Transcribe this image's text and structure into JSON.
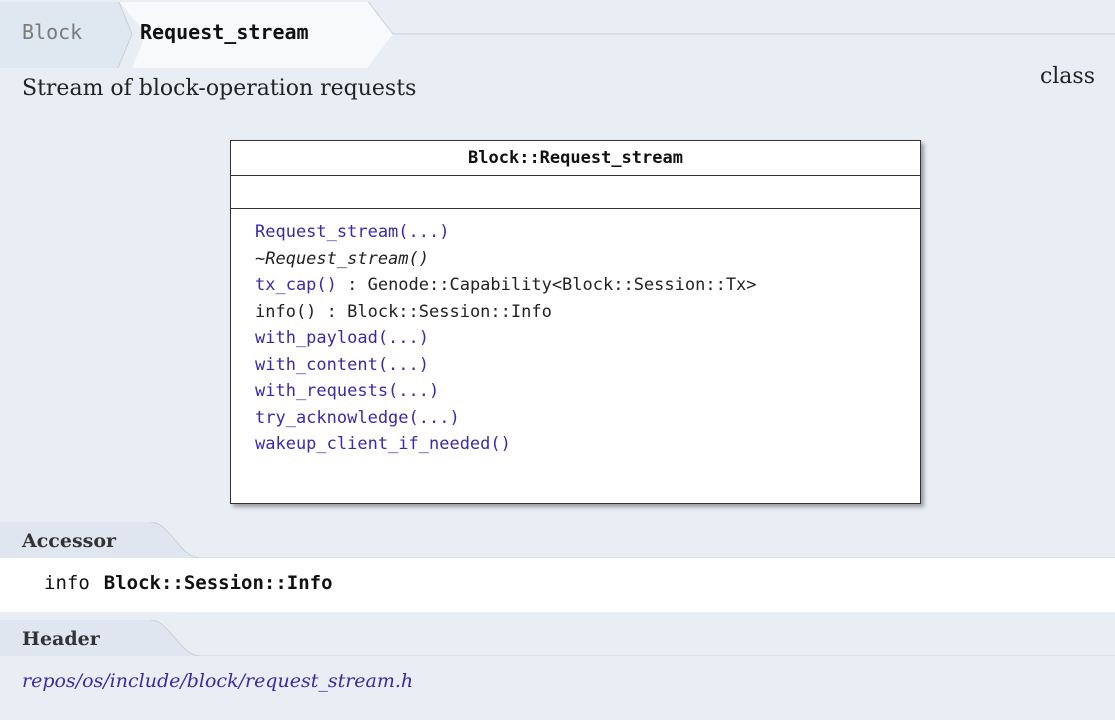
{
  "breadcrumb": {
    "parent": "Block",
    "current": "Request_stream"
  },
  "kind": "class",
  "brief": "Stream of block-operation requests",
  "uml": {
    "title": "Block::Request_stream",
    "methods": [
      {
        "name": "Request_stream(...)",
        "suffix": "",
        "link": true,
        "italic": false
      },
      {
        "name": "~Request_stream()",
        "suffix": "",
        "link": false,
        "italic": true
      },
      {
        "name": "tx_cap()",
        "suffix": " : Genode::Capability<Block::Session::Tx>",
        "link": true,
        "italic": false
      },
      {
        "name": "info()",
        "suffix": " : Block::Session::Info",
        "link": false,
        "italic": false
      },
      {
        "name": "with_payload(...)",
        "suffix": "",
        "link": true,
        "italic": false
      },
      {
        "name": "with_content(...)",
        "suffix": "",
        "link": true,
        "italic": false
      },
      {
        "name": "with_requests(...)",
        "suffix": "",
        "link": true,
        "italic": false
      },
      {
        "name": "try_acknowledge(...)",
        "suffix": "",
        "link": true,
        "italic": false
      },
      {
        "name": "wakeup_client_if_needed()",
        "suffix": "",
        "link": true,
        "italic": false
      }
    ]
  },
  "accessor": {
    "heading": "Accessor",
    "name": "info",
    "type": "Block::Session::Info"
  },
  "header": {
    "heading": "Header",
    "path": "repos/os/include/block/request_stream.h"
  },
  "colors": {
    "background": "#e9eef5",
    "link": "#3a2aa8"
  }
}
